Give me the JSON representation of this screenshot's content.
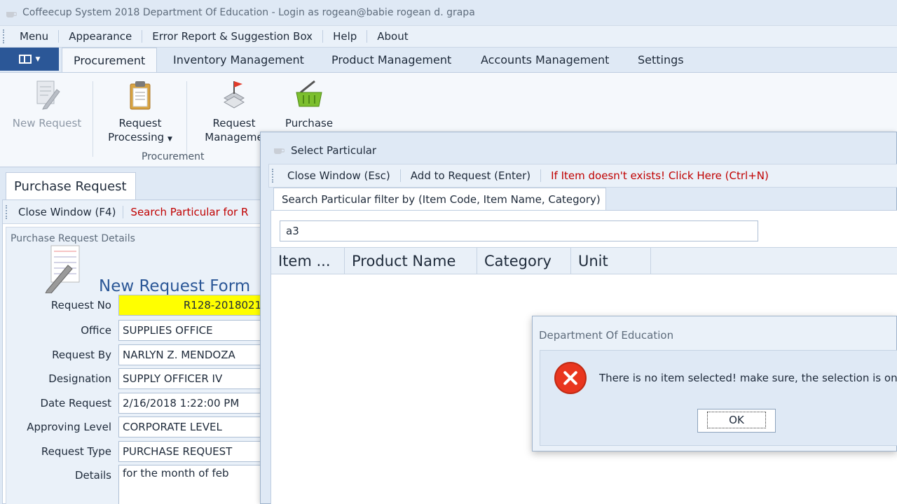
{
  "window": {
    "title": "Coffeecup System 2018 Department Of Education - Login as rogean@babie rogean d. grapa"
  },
  "menu": {
    "items": [
      "Menu",
      "Appearance",
      "Error Report & Suggestion Box",
      "Help",
      "About"
    ]
  },
  "ribbon": {
    "tabs": [
      "Procurement",
      "Inventory Management",
      "Product Management",
      "Accounts Management",
      "Settings"
    ],
    "active_tab": "Procurement",
    "buttons": {
      "new_request": "New Request",
      "request_processing_1": "Request",
      "request_processing_2": "Processing",
      "request_management_1": "Request",
      "request_management_2": "Manageme",
      "purchase": "Purchase"
    },
    "group_label": "Procurement"
  },
  "purchase_request": {
    "tab_label": "Purchase Request",
    "toolbar": {
      "close": "Close Window (F4)",
      "search": "Search Particular for R"
    },
    "panel_title": "Purchase Request Details",
    "form_title": "New Request Form",
    "fields": [
      {
        "label": "Request No",
        "value": "R128-2018021("
      },
      {
        "label": "Office",
        "value": "SUPPLIES OFFICE"
      },
      {
        "label": "Request By",
        "value": "NARLYN Z. MENDOZA"
      },
      {
        "label": "Designation",
        "value": "SUPPLY OFFICER IV"
      },
      {
        "label": "Date Request",
        "value": "2/16/2018 1:22:00 PM"
      },
      {
        "label": "Approving Level",
        "value": "CORPORATE LEVEL"
      },
      {
        "label": "Request Type",
        "value": "PURCHASE REQUEST"
      },
      {
        "label": "Details",
        "value": "for the month of feb"
      }
    ]
  },
  "select_particular": {
    "title": "Select Particular",
    "toolbar": {
      "close": "Close Window (Esc)",
      "add": "Add to Request (Enter)",
      "create": "If Item doesn't exists! Click Here (Ctrl+N)"
    },
    "search_tab": "Search Particular filter by (Item Code, Item Name, Category)",
    "search_value": "a3",
    "columns": [
      "Item ...",
      "Product Name",
      "Category",
      "Unit"
    ]
  },
  "message_box": {
    "title": "Department Of Education",
    "text": "There is no item selected! make sure, the selection is on the",
    "ok_label": "OK"
  },
  "colors": {
    "accent": "#2b5797",
    "error": "#e9361f",
    "warning_text": "#c00000",
    "highlight": "#ffff00"
  }
}
